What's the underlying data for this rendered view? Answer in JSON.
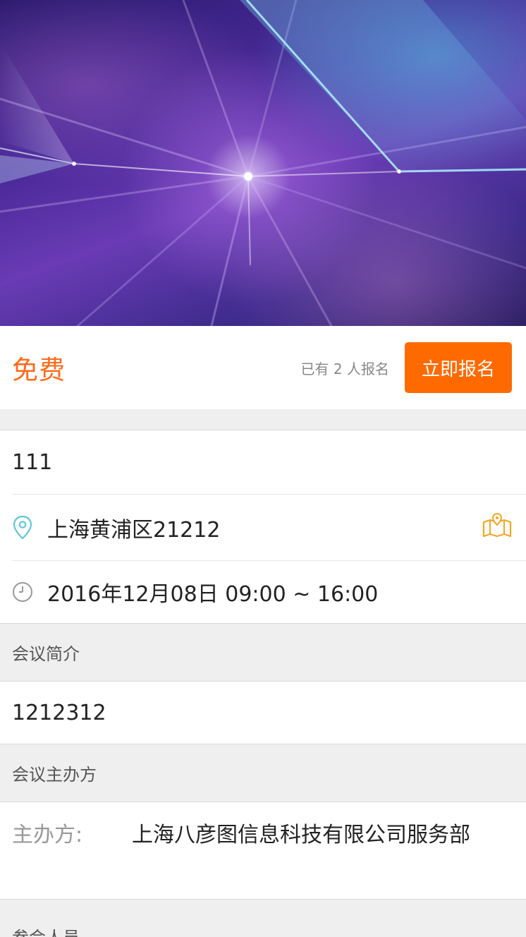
{
  "event": {
    "price": "免费",
    "registered_text": "已有 2 人报名",
    "register_button": "立即报名",
    "title": "111",
    "location": "上海黄浦区21212",
    "time": "2016年12月08日 09:00 ~ 16:00"
  },
  "intro": {
    "header": "会议简介",
    "text": "1212312"
  },
  "organizer": {
    "header": "会议主办方",
    "label": "主办方:",
    "value": "上海八彦图信息科技有限公司服务部"
  },
  "attendees": {
    "header": "参会人员"
  },
  "icons": {
    "location": "location-pin-icon",
    "map": "map-icon",
    "clock": "clock-icon"
  },
  "colors": {
    "accent": "#ff6a00",
    "location_icon": "#5fc8d8",
    "map_icon": "#f5a623"
  }
}
